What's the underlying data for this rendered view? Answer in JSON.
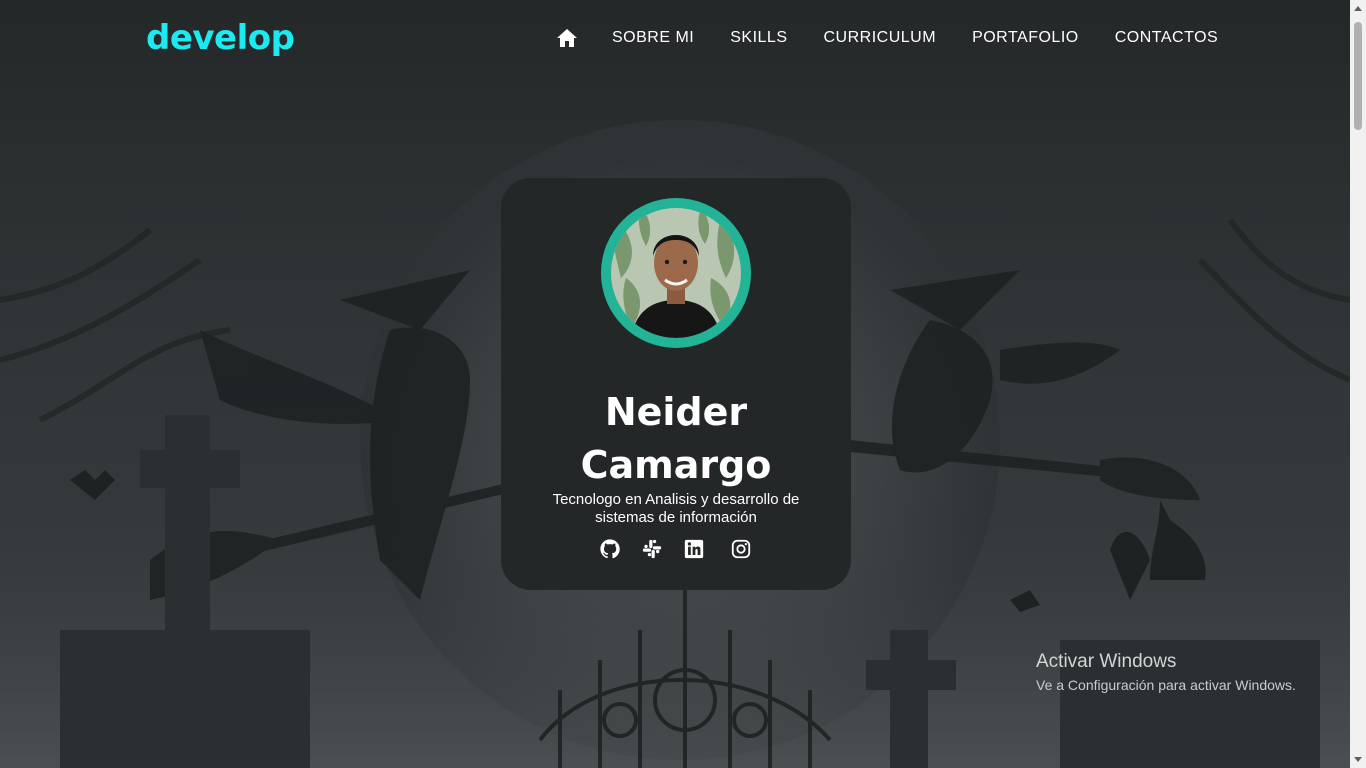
{
  "brand": {
    "logo_text": "develop",
    "accent": "#1de9f0"
  },
  "nav": {
    "home_icon": "home-icon",
    "items": [
      {
        "label": "SOBRE MI"
      },
      {
        "label": "SKILLS"
      },
      {
        "label": "CURRICULUM"
      },
      {
        "label": "PORTAFOLIO"
      },
      {
        "label": "CONTACTOS"
      }
    ]
  },
  "profile": {
    "name_line1": "Neider",
    "name_line2": "Camargo",
    "subtitle": "Tecnologo en Analisis y desarrollo de sistemas de información",
    "ring_color": "#23b497",
    "socials": [
      "github-icon",
      "slack-icon",
      "linkedin-icon",
      "instagram-icon"
    ]
  },
  "system": {
    "activation_title": "Activar Windows",
    "activation_subtitle": "Ve a Configuración para activar Windows."
  }
}
